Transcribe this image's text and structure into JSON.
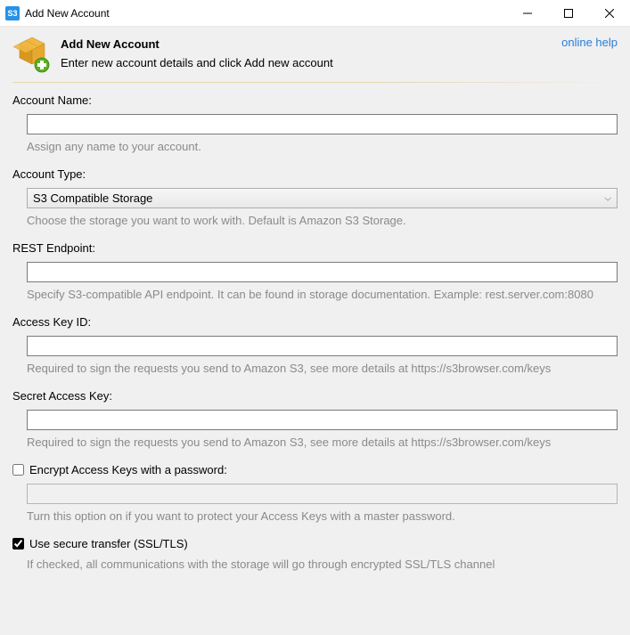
{
  "window": {
    "title": "Add New Account",
    "app_icon_text": "S3"
  },
  "header": {
    "title": "Add New Account",
    "subtitle": "Enter new account details and click Add new account",
    "online_help": "online help"
  },
  "fields": {
    "account_name": {
      "label": "Account Name:",
      "value": "",
      "hint": "Assign any name to your account."
    },
    "account_type": {
      "label": "Account Type:",
      "value": "S3 Compatible Storage",
      "hint": "Choose the storage you want to work with. Default is Amazon S3 Storage."
    },
    "rest_endpoint": {
      "label": "REST Endpoint:",
      "value": "",
      "hint": "Specify S3-compatible API endpoint. It can be found in storage documentation. Example: rest.server.com:8080"
    },
    "access_key": {
      "label": "Access Key ID:",
      "value": "",
      "hint": "Required to sign the requests you send to Amazon S3, see more details at https://s3browser.com/keys"
    },
    "secret_key": {
      "label": "Secret Access Key:",
      "value": "",
      "hint": "Required to sign the requests you send to Amazon S3, see more details at https://s3browser.com/keys"
    },
    "encrypt_keys": {
      "label": "Encrypt Access Keys with a password:",
      "checked": false,
      "value": "",
      "hint": "Turn this option on if you want to protect your Access Keys with a master password."
    },
    "secure_transfer": {
      "label": "Use secure transfer (SSL/TLS)",
      "checked": true,
      "hint": "If checked, all communications with the storage will go through encrypted SSL/TLS channel"
    }
  }
}
